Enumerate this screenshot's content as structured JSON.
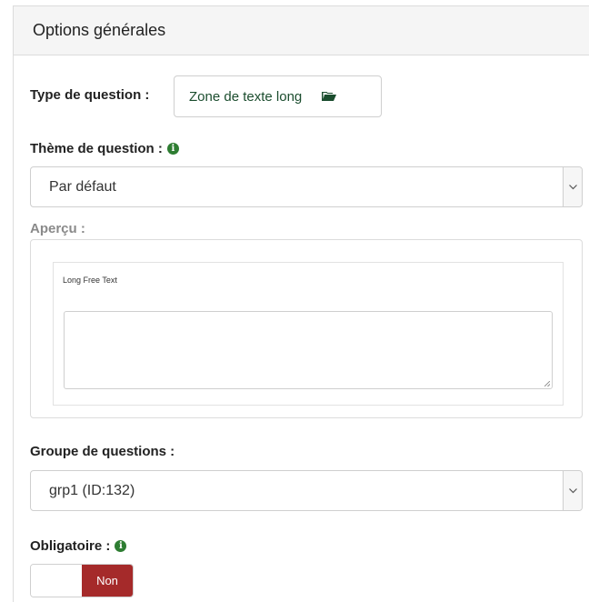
{
  "panel": {
    "title": "Options générales"
  },
  "question_type": {
    "label": "Type de question :",
    "value": "Zone de texte long",
    "icon": "folder-open-icon"
  },
  "question_theme": {
    "label": "Thème de question :",
    "info_icon": "info-icon",
    "selected": "Par défaut"
  },
  "preview": {
    "label": "Aperçu :",
    "question_text": "Long Free Text"
  },
  "question_group": {
    "label": "Groupe de questions :",
    "selected": "grp1 (ID:132)"
  },
  "mandatory": {
    "label": "Obligatoire :",
    "info_icon": "info-icon",
    "toggle_label": "Non",
    "toggle_color": "#a52a2a"
  },
  "colors": {
    "info_green": "#2e7d32",
    "type_text": "#1b4d2e",
    "header_bg": "#f5f5f5"
  }
}
